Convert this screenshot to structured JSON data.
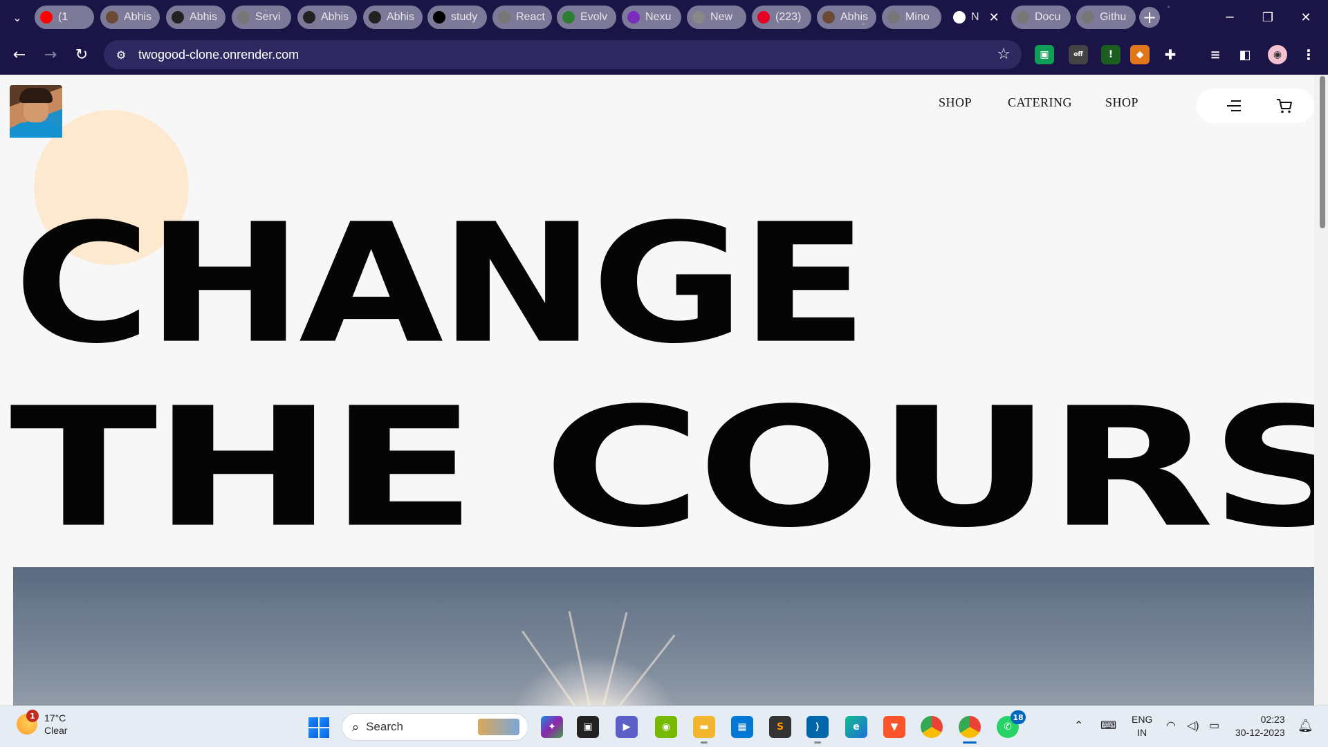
{
  "browser": {
    "tabs": [
      {
        "label": "(1",
        "favicon": "youtube-icon",
        "color": "#ff0000"
      },
      {
        "label": "Abhis",
        "favicon": "avatar-icon",
        "color": "#6b4a35"
      },
      {
        "label": "Abhis",
        "favicon": "github-icon",
        "color": "#222222"
      },
      {
        "label": "Servi",
        "favicon": "globe-icon",
        "color": "#777777"
      },
      {
        "label": "Abhis",
        "favicon": "github-icon",
        "color": "#222222"
      },
      {
        "label": "Abhis",
        "favicon": "github-icon",
        "color": "#222222"
      },
      {
        "label": "study",
        "favicon": "triangle-icon",
        "color": "#000000"
      },
      {
        "label": "React",
        "favicon": "globe-icon",
        "color": "#777777"
      },
      {
        "label": "Evolv",
        "favicon": "mountain-icon",
        "color": "#2e7d32"
      },
      {
        "label": "Nexu",
        "favicon": "nexus-icon",
        "color": "#7b2cbf"
      },
      {
        "label": "New",
        "favicon": "chrome-icon",
        "color": "#888888"
      },
      {
        "label": "(223)",
        "favicon": "pinterest-icon",
        "color": "#e60023"
      },
      {
        "label": "Abhis",
        "favicon": "avatar-icon",
        "color": "#6b4a35"
      },
      {
        "label": "Mino",
        "favicon": "globe-icon",
        "color": "#777777"
      },
      {
        "label": "N",
        "favicon": "play-icon",
        "color": "#ffffff"
      },
      {
        "label": "Docu",
        "favicon": "globe-icon",
        "color": "#777777"
      },
      {
        "label": "Githu",
        "favicon": "globe-icon",
        "color": "#777777"
      }
    ],
    "url": "twogood-clone.onrender.com"
  },
  "site": {
    "nav": [
      "SHOP",
      "CATERING",
      "SHOP"
    ],
    "hero": {
      "line1": "CHANGE",
      "line2": "THE COURSE"
    },
    "accent_blob": "#fde9cf"
  },
  "taskbar": {
    "weather_temp": "17°C",
    "weather_desc": "Clear",
    "weather_badge": "1",
    "search_label": "Search",
    "whatsapp_badge": "18",
    "lang1": "ENG",
    "lang2": "IN",
    "time": "02:23",
    "date": "30-12-2023"
  }
}
